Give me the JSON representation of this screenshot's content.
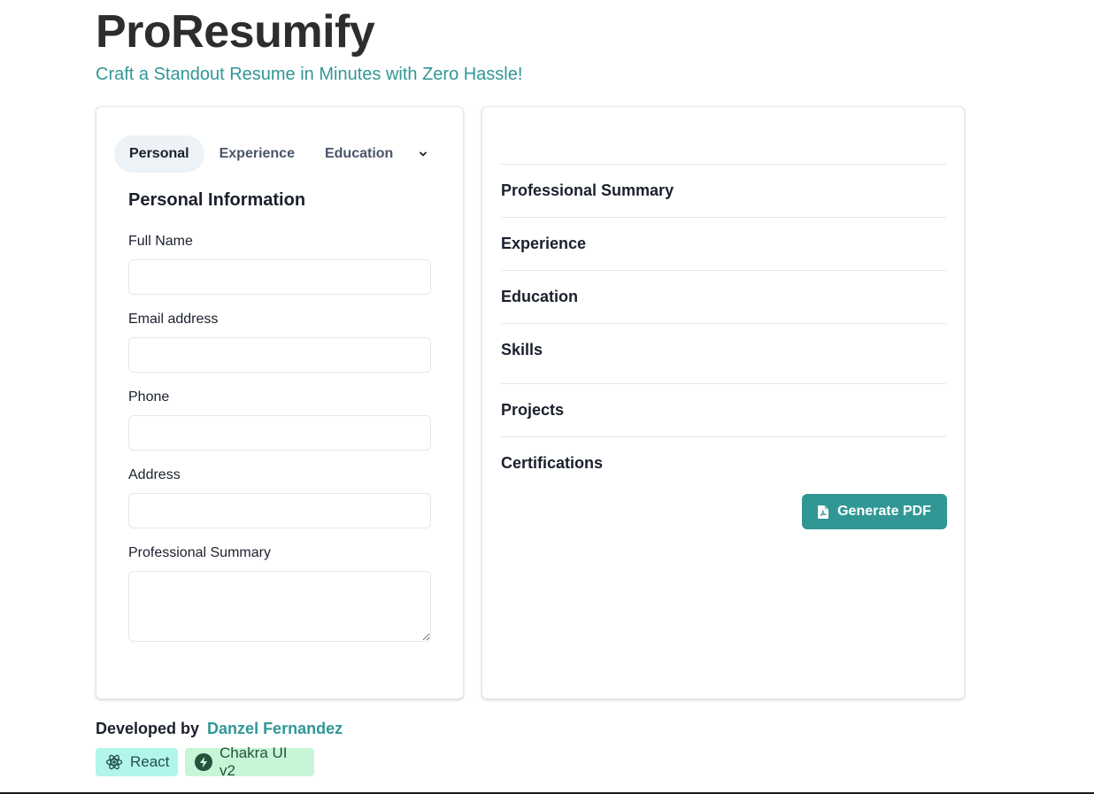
{
  "header": {
    "title": "ProResumify",
    "subtitle": "Craft a Standout Resume in Minutes with Zero Hassle!"
  },
  "form": {
    "tabs": [
      "Personal",
      "Experience",
      "Education"
    ],
    "active_tab": "Personal",
    "section_title": "Personal Information",
    "fields": {
      "full_name": {
        "label": "Full Name",
        "value": ""
      },
      "email": {
        "label": "Email address",
        "value": ""
      },
      "phone": {
        "label": "Phone",
        "value": ""
      },
      "address": {
        "label": "Address",
        "value": ""
      },
      "summary": {
        "label": "Professional Summary",
        "value": ""
      }
    }
  },
  "preview": {
    "sections": [
      "Professional Summary",
      "Experience",
      "Education",
      "Skills",
      "Projects",
      "Certifications"
    ],
    "generate_button": "Generate PDF"
  },
  "footer": {
    "developed_by": "Developed by",
    "author": "Danzel Fernandez",
    "badges": {
      "react": {
        "label": "React",
        "icon": "react-icon"
      },
      "chakra": {
        "label": "Chakra UI v2",
        "icon": "lightning-bolt-icon"
      }
    }
  },
  "colors": {
    "accent": "#319795",
    "title": "#2d2d2d",
    "react_badge_bg": "#b2f5ea",
    "chakra_badge_bg": "#c6f6d5"
  }
}
